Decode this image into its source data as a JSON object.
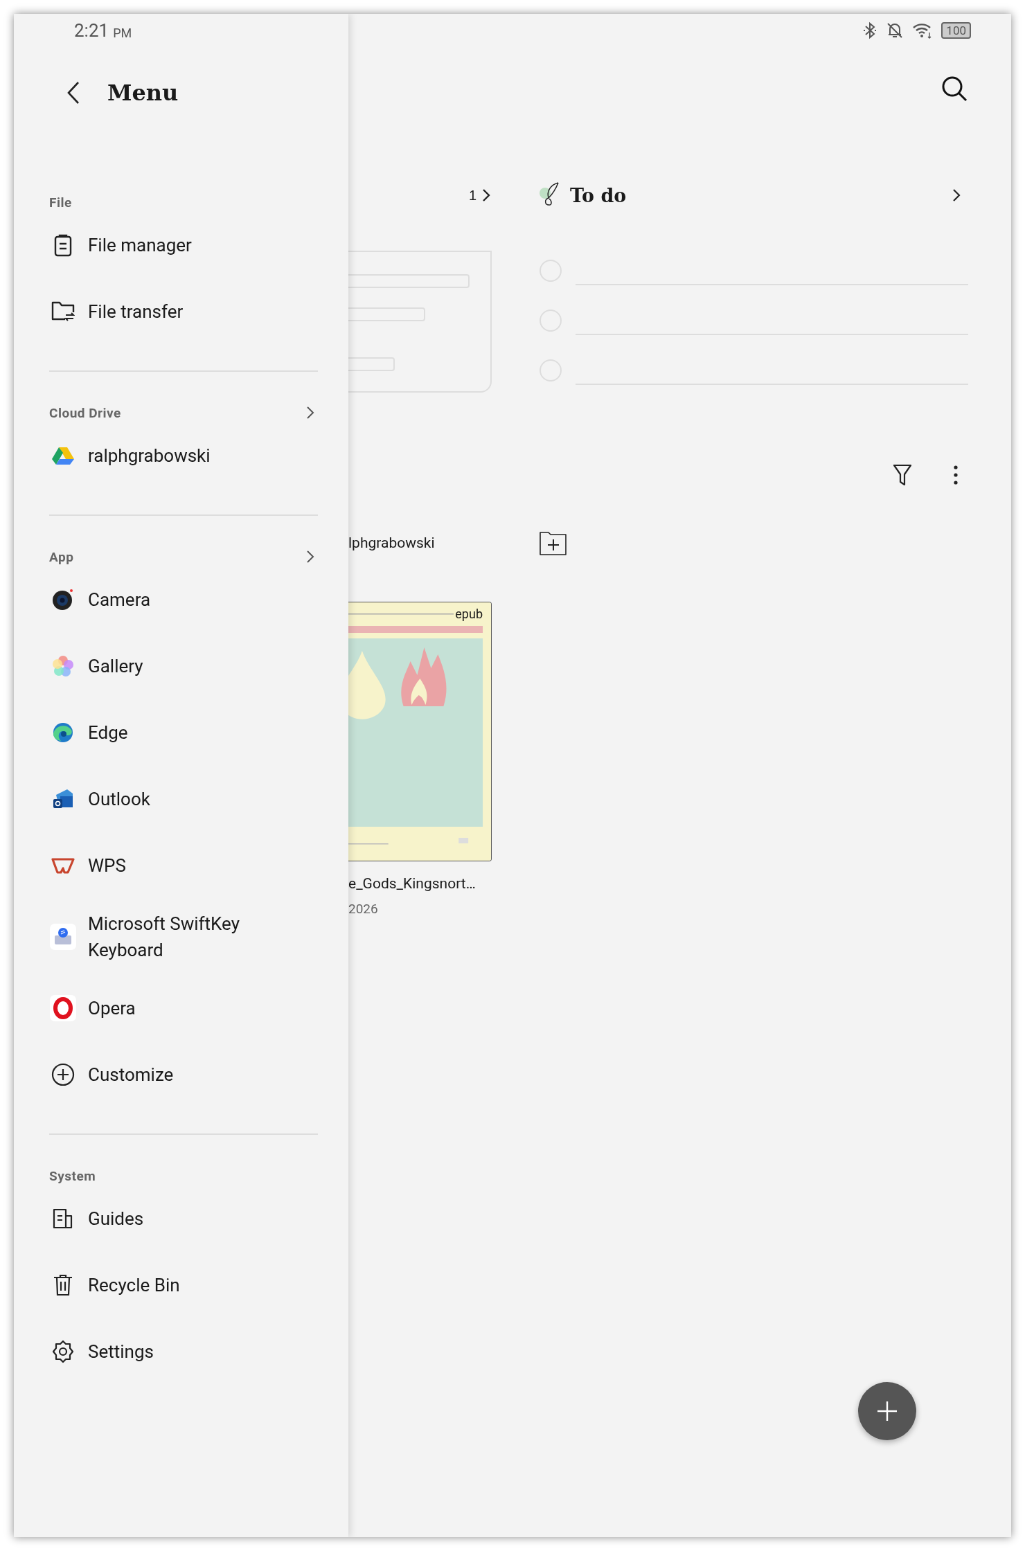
{
  "status_bar": {
    "time": "2:21",
    "meridiem": "PM",
    "battery": "100"
  },
  "drawer": {
    "title": "Menu",
    "sections": [
      {
        "label": "File",
        "has_more": false,
        "items": [
          {
            "label": "File manager",
            "kind": "clipboard"
          },
          {
            "label": "File transfer",
            "kind": "folder"
          }
        ]
      },
      {
        "label": "Cloud Drive",
        "has_more": true,
        "items": [
          {
            "label": "ralphgrabowski",
            "kind": "triangle"
          }
        ]
      },
      {
        "label": "App",
        "has_more": true,
        "items": [
          {
            "label": "Camera",
            "kind": "lens"
          },
          {
            "label": "Gallery",
            "kind": "flower"
          },
          {
            "label": "Edge",
            "kind": "swirl"
          },
          {
            "label": "Outlook",
            "kind": "envelope"
          },
          {
            "label": "WPS",
            "kind": "wmark"
          },
          {
            "label": "Microsoft SwiftKey Keyboard",
            "kind": "keyboard"
          },
          {
            "label": "Opera",
            "kind": "ring"
          },
          {
            "label": "Customize",
            "kind": "add"
          }
        ]
      },
      {
        "label": "System",
        "has_more": false,
        "items": [
          {
            "label": "Guides",
            "kind": "document"
          },
          {
            "label": "Recycle Bin",
            "kind": "trash"
          },
          {
            "label": "Settings",
            "kind": "gear"
          }
        ]
      }
    ]
  },
  "notes": {
    "count": "1"
  },
  "todo": {
    "title": "To do",
    "items": [
      {
        "checked": false
      },
      {
        "checked": false
      },
      {
        "checked": false
      }
    ]
  },
  "files": {
    "account": "lphgrabowski",
    "items": [
      {
        "badge": "epub",
        "name": "e_Gods_Kingsnort…",
        "date": "2026"
      }
    ]
  }
}
